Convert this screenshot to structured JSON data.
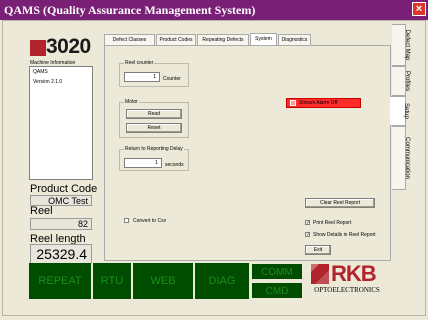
{
  "window": {
    "title": "QAMS (Quality Assurance Management System)",
    "close_glyph": "×"
  },
  "logo": {
    "text": "3020"
  },
  "machine_info": {
    "label": "Machine Information",
    "lines": [
      "QAMS",
      "Version 2.1.0"
    ]
  },
  "product_code": {
    "label": "Product Code",
    "value": "OMC Test"
  },
  "reel": {
    "label": "Reel",
    "value": "82"
  },
  "reel_length": {
    "label": "Reel length",
    "value": "25329.4"
  },
  "tabs": [
    {
      "label": "Defect Classes"
    },
    {
      "label": "Product Codes"
    },
    {
      "label": "Repeating Defects"
    },
    {
      "label": "System",
      "active": true
    },
    {
      "label": "Diagnostics"
    }
  ],
  "side_tabs": [
    {
      "label": "Defect Map"
    },
    {
      "label": "Profiles"
    },
    {
      "label": "Setup",
      "active": true
    },
    {
      "label": "Communication"
    }
  ],
  "reel_counter": {
    "title": "Reel counter",
    "value": "1",
    "unit": "Counter"
  },
  "motor": {
    "title": "Motor",
    "read_label": "Read",
    "reset_label": "Reset"
  },
  "return_delay": {
    "title": "Return to Reporting Delay",
    "value": "1",
    "unit": "seconds"
  },
  "stream_alarm": {
    "label": "Stream Alarm Off",
    "color": "#ff2a2a"
  },
  "convert_csv": {
    "label": "Convert to Csv",
    "checked": false
  },
  "clear_reel_report": {
    "label": "Clear Reel Report"
  },
  "print_reel_report": {
    "label": "Print Reel Report",
    "checked": true
  },
  "show_details": {
    "label": "Show Details in Reel Report",
    "checked": true
  },
  "exit": {
    "label": "Exit"
  },
  "bottom_buttons": {
    "repeat": "REPEAT",
    "rtu": "RTU",
    "web": "WEB",
    "diag": "DIAG",
    "comm": "COMM",
    "cmd": "CMD"
  },
  "brand": {
    "name": "RKB",
    "sub": "OPTOELECTRONICS",
    "color": "#b2242b"
  },
  "colors": {
    "titlebar": "#7a1f76",
    "green_button": "#004c00",
    "green_text": "#1b8e1b"
  }
}
